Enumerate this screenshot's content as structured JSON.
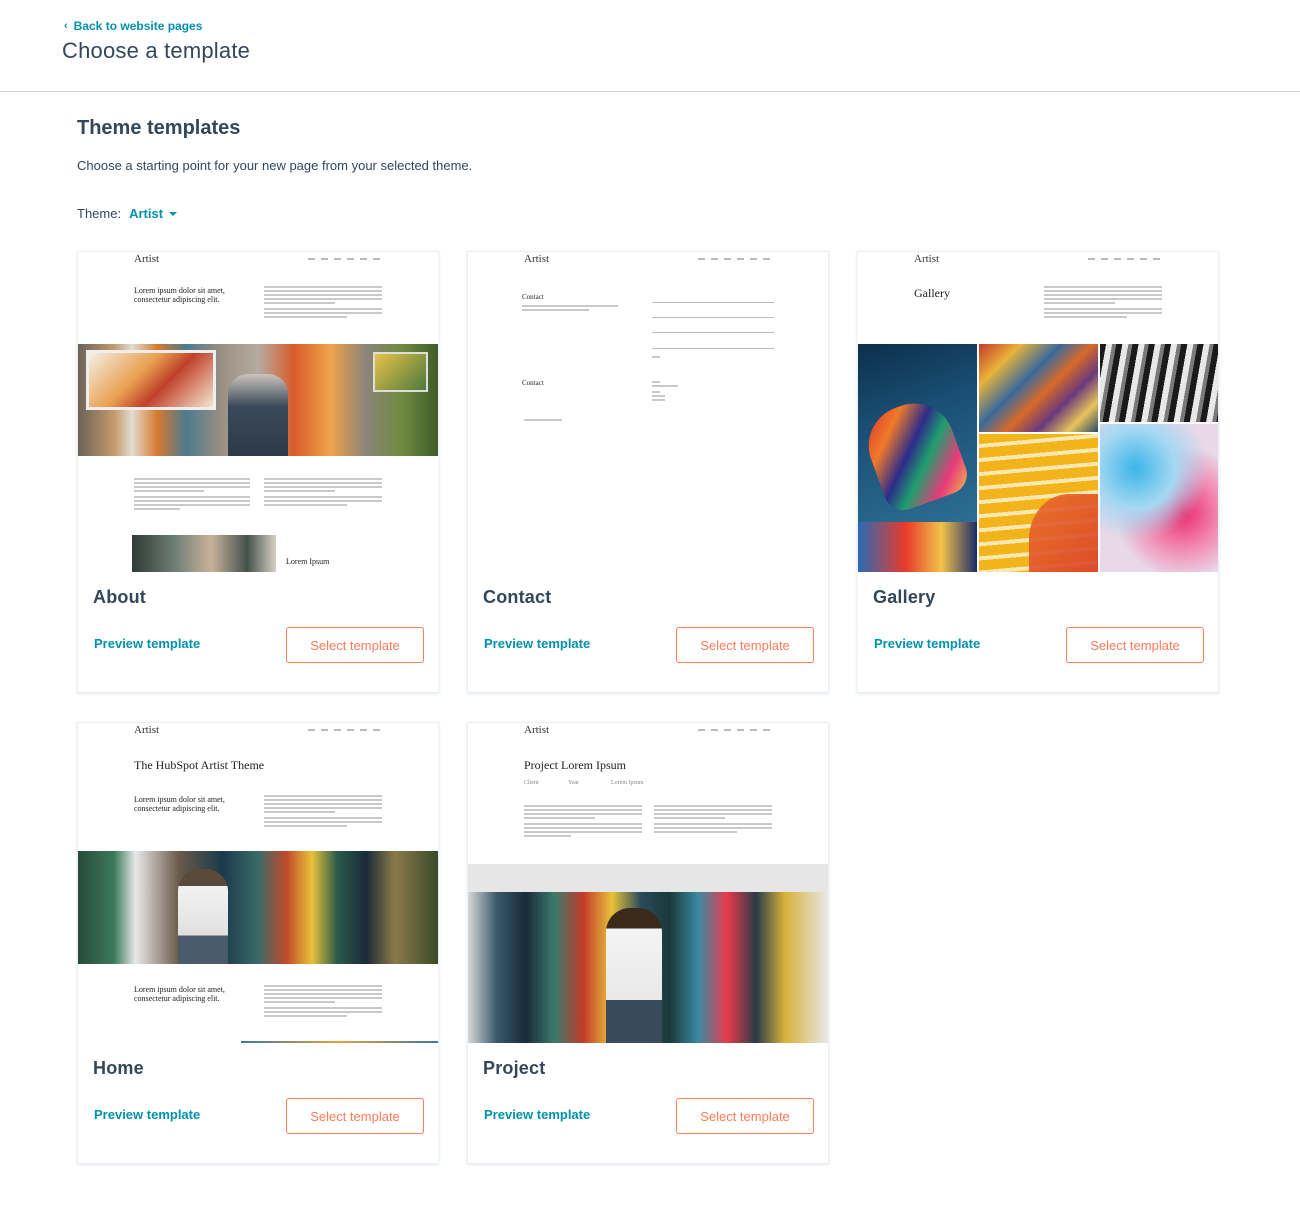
{
  "header": {
    "back_label": "Back to website pages",
    "title": "Choose a template"
  },
  "section": {
    "title": "Theme templates",
    "description": "Choose a starting point for your new page from your selected theme.",
    "theme_label": "Theme:",
    "theme_value": "Artist"
  },
  "colors": {
    "link": "#0091ae",
    "button_accent": "#ff7a59",
    "text": "#33475b"
  },
  "templates": [
    {
      "name": "About",
      "preview_label": "Preview template",
      "select_label": "Select template"
    },
    {
      "name": "Contact",
      "preview_label": "Preview template",
      "select_label": "Select template"
    },
    {
      "name": "Gallery",
      "preview_label": "Preview template",
      "select_label": "Select template"
    },
    {
      "name": "Home",
      "preview_label": "Preview template",
      "select_label": "Select template"
    },
    {
      "name": "Project",
      "preview_label": "Preview template",
      "select_label": "Select template"
    }
  ],
  "thumbnails": {
    "logo": "Artist",
    "about": {
      "tagline": "Lorem ipsum dolor sit amet, consectetur adipiscing elit.",
      "caption": "Lorem Ipsum"
    },
    "contact": {
      "heading1": "Contact",
      "heading2": "Contact"
    },
    "gallery": {
      "heading": "Gallery"
    },
    "home": {
      "heading": "The HubSpot Artist Theme",
      "tagline": "Lorem ipsum dolor sit amet, consectetur adipiscing elit.",
      "tagline2": "Lorem ipsum dolor sit amet, consectetur adipiscing elit."
    },
    "project": {
      "heading": "Project Lorem Ipsum",
      "meta1": "Client",
      "meta2": "Year",
      "meta3": "Lorem Ipsum"
    }
  }
}
